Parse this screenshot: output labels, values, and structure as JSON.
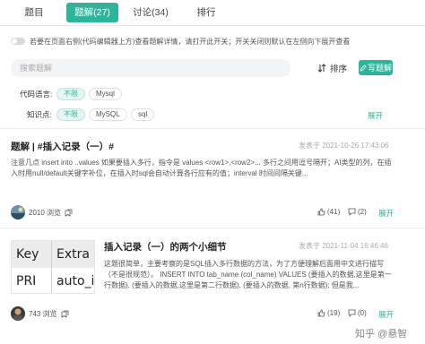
{
  "tabs": [
    {
      "label": "题目",
      "active": false
    },
    {
      "label": "题解(27)",
      "active": true
    },
    {
      "label": "讨论(34)",
      "active": false
    },
    {
      "label": "排行",
      "active": false
    }
  ],
  "notice": "若要在页面右侧(代码编辑器上方)查看题解详情，请打开此开关；开关关闭则默认在左侧向下展开查看",
  "search": {
    "placeholder": "搜索题解",
    "value": ""
  },
  "sort_label": "排序",
  "write_label": "写题解",
  "filters": {
    "language": {
      "label": "代码语言:",
      "chips": [
        "不限",
        "Mysql"
      ],
      "selected": "不限"
    },
    "knowledge": {
      "label": "知识点:",
      "chips": [
        "不限",
        "MySQL",
        "sql"
      ],
      "selected": "不限"
    },
    "expand": "展开"
  },
  "posts": [
    {
      "title": "题解 | #插入记录（一）#",
      "time": "发表于 2021-10-26 17:43:06",
      "excerpt": "注意几点 insert into ..values 如果要插入多行，指令是 values <row1>,<row2>... 多行之间用逗号隔开；AI类型的列，在插入时用null/default关键字补位，在插入时sql会自动计算各行应有的值；interval 时间间隔关键...",
      "views": "2010 浏览",
      "likes": "(41)",
      "comments": "(2)",
      "expand": "展开"
    },
    {
      "title": "插入记录（一）的两个小细节",
      "time": "发表于 2021-11-04 16:46:46",
      "excerpt": "这题很简单，主要考察的是SQL插入多行数据的方法，为了方便理解后面用中文进行描写（不是很规范）。 INSERT INTO tab_name (col_name) VALUES (要插入的数据,这里是第一行数据), (要插入的数据,这里是第二行数据), (要插入的数据, 第n行数据); 但是我...",
      "views": "743 浏览",
      "likes": "(19)",
      "comments": "(0)",
      "expand": "展开",
      "thumb": {
        "col1_head": "Key",
        "col2_head": "Extra",
        "col1_val": "PRI",
        "col2_val": "auto_ir"
      }
    }
  ],
  "watermark": "知乎 @悬智",
  "colors": {
    "accent": "#2db59c"
  }
}
